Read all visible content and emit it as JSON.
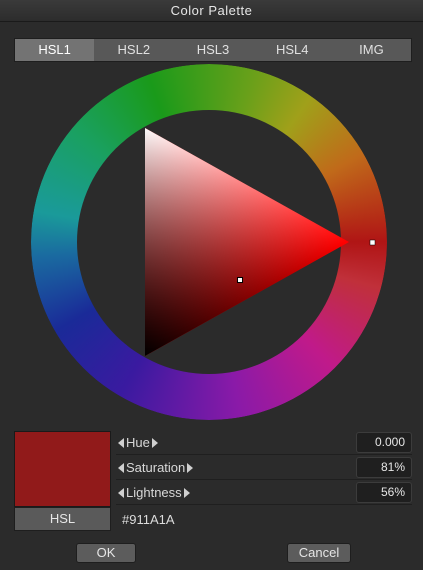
{
  "window": {
    "title": "Color Palette"
  },
  "tabs": [
    {
      "label": "HSL1",
      "active": true
    },
    {
      "label": "HSL2",
      "active": false
    },
    {
      "label": "HSL3",
      "active": false
    },
    {
      "label": "HSL4",
      "active": false
    },
    {
      "label": "IMG",
      "active": false
    }
  ],
  "color": {
    "swatch": "#911A1A",
    "hex_text": "#911A1A",
    "hue_color": "#ff0000"
  },
  "mode_button": {
    "label": "HSL"
  },
  "params": [
    {
      "label": "Hue",
      "value": "0.000"
    },
    {
      "label": "Saturation",
      "value": "81%"
    },
    {
      "label": "Lightness",
      "value": "56%"
    }
  ],
  "buttons": {
    "ok": "OK",
    "cancel": "Cancel"
  },
  "icons": {
    "decrement": "triangle-left-icon",
    "increment": "triangle-right-icon"
  }
}
